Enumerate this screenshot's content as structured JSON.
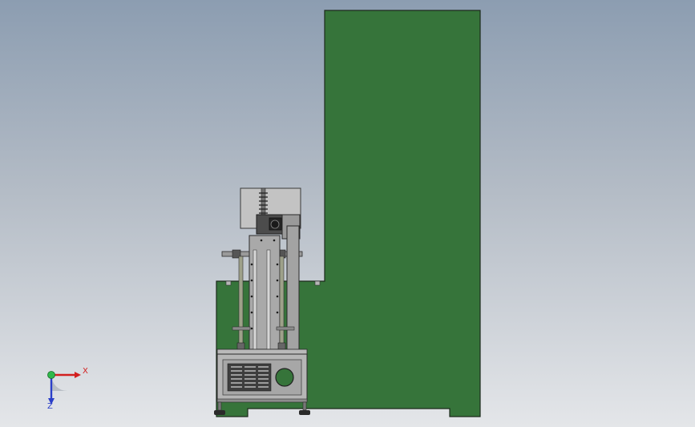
{
  "viewport": {
    "background_top": "#8c9db1",
    "background_bottom": "#e4e6e9"
  },
  "model": {
    "frame_color": "#36743a",
    "steel_color": "#a8a8a8",
    "dark_steel_color": "#5a5a5a"
  },
  "triad": {
    "x_label": "X",
    "y_label": "Y",
    "z_label": "Z",
    "x_color": "#d21f1f",
    "y_color": "#2fb84a",
    "z_color": "#2b3fc9"
  }
}
